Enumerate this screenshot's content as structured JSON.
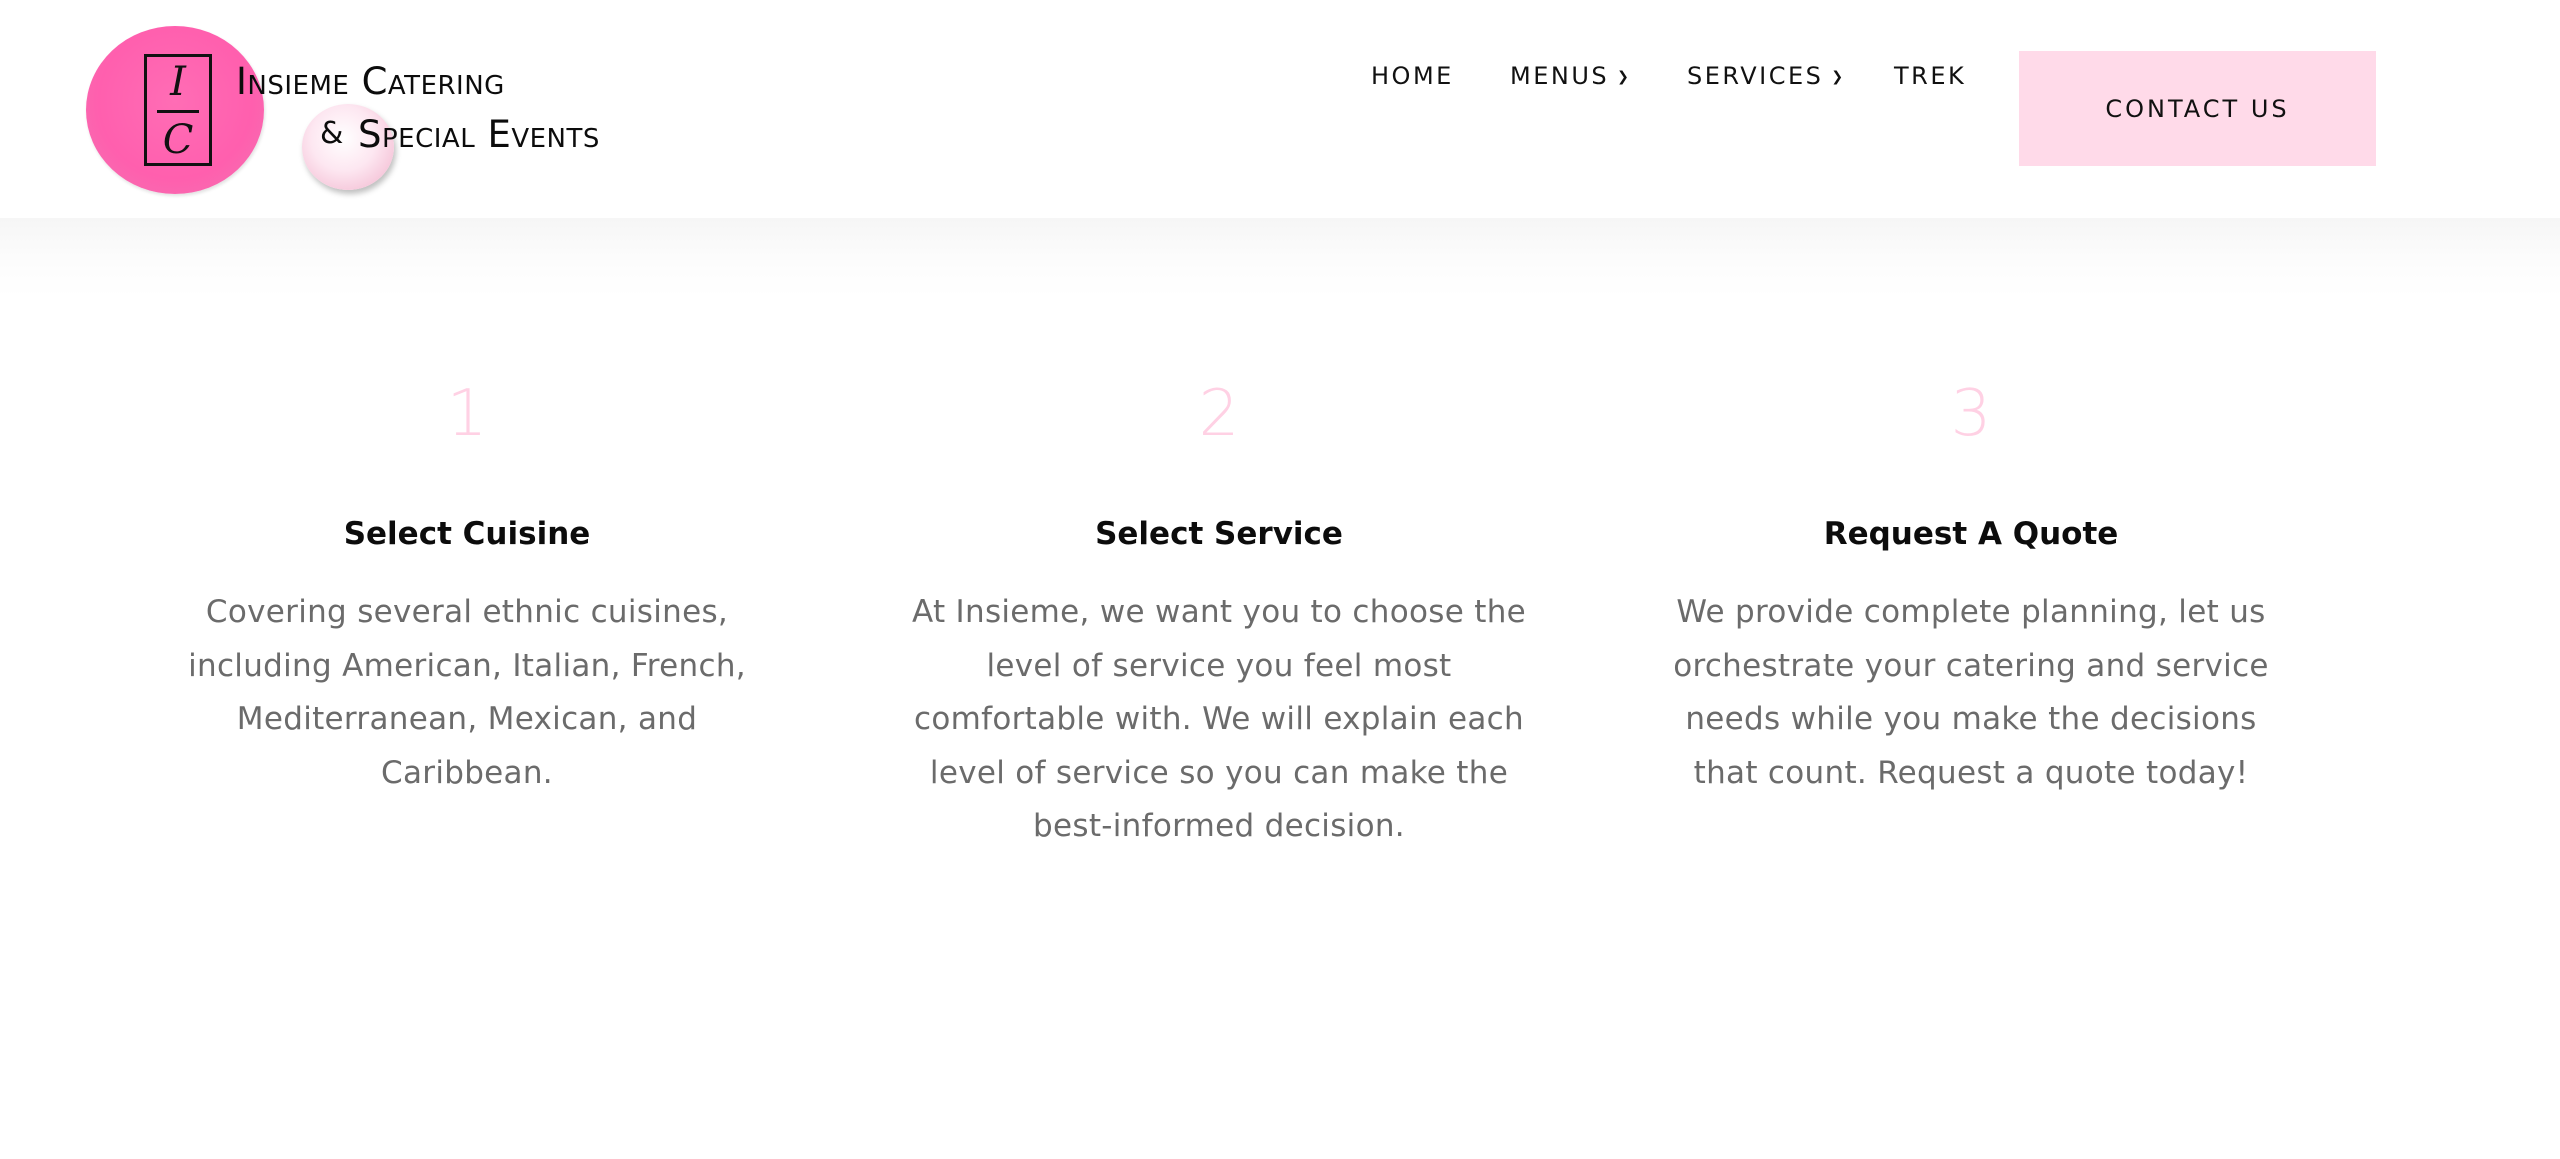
{
  "brand": {
    "monogram_top": "I",
    "monogram_bottom": "C",
    "line1": "Insieme Catering",
    "line2_amp": "&",
    "line2": "Special Events",
    "colors": {
      "logo_pink": "#ff5fae",
      "accent_pink": "#ffdae9",
      "number_pink": "#ffd1e4"
    }
  },
  "nav": {
    "items": [
      {
        "label": "HOME",
        "has_dropdown": false
      },
      {
        "label": "MENUS",
        "has_dropdown": true,
        "icon": "chevron-down-icon"
      },
      {
        "label": "SERVICES",
        "has_dropdown": true,
        "icon": "chevron-down-icon"
      },
      {
        "label": "TREK",
        "has_dropdown": false
      }
    ],
    "contact_label": "CONTACT US"
  },
  "steps": [
    {
      "number": "1",
      "title": "Select Cuisine",
      "lines": [
        "Covering several ethnic cuisines,",
        "including American, Italian, French,",
        "Mediterranean, Mexican, and",
        "Caribbean."
      ]
    },
    {
      "number": "2",
      "title": "Select Service",
      "lines": [
        "At Insieme, we want you to choose the",
        "level of service you feel most",
        "comfortable with. We will explain each",
        "level of service so you can make the",
        "best-informed decision."
      ]
    },
    {
      "number": "3",
      "title": "Request A Quote",
      "lines": [
        "We provide complete planning, let us",
        "orchestrate your catering and service",
        "needs while you make the decisions",
        "that count. Request a quote today!"
      ]
    }
  ]
}
